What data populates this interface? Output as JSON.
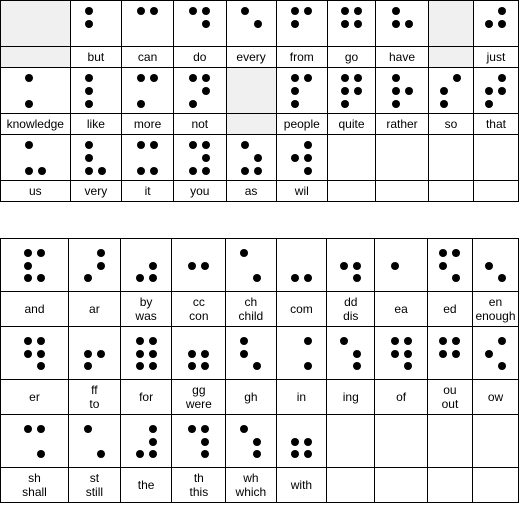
{
  "meta": {
    "title": "Braille contractions chart",
    "dot_color": "#000000",
    "grid_line_color": "#000000",
    "empty_cell_fill": "#f0f0f0",
    "background": "#ffffff"
  },
  "tables": [
    {
      "name": "alphabetic-wordsigns",
      "rows": [
        {
          "cells": [
            {
              "labels": [],
              "dots": [],
              "state": "empty"
            },
            {
              "labels": [
                "but"
              ],
              "dots": [
                1,
                2
              ],
              "state": "filled"
            },
            {
              "labels": [
                "can"
              ],
              "dots": [
                1,
                4
              ],
              "state": "filled"
            },
            {
              "labels": [
                "do"
              ],
              "dots": [
                1,
                4,
                5
              ],
              "state": "filled"
            },
            {
              "labels": [
                "every"
              ],
              "dots": [
                1,
                5
              ],
              "state": "filled"
            },
            {
              "labels": [
                "from"
              ],
              "dots": [
                1,
                2,
                4
              ],
              "state": "filled"
            },
            {
              "labels": [
                "go"
              ],
              "dots": [
                1,
                2,
                4,
                5
              ],
              "state": "filled"
            },
            {
              "labels": [
                "have"
              ],
              "dots": [
                1,
                2,
                5
              ],
              "state": "filled"
            },
            {
              "labels": [],
              "dots": [],
              "state": "empty"
            },
            {
              "labels": [
                "just"
              ],
              "dots": [
                2,
                4,
                5
              ],
              "state": "filled"
            }
          ]
        },
        {
          "cells": [
            {
              "labels": [
                "knowledge"
              ],
              "dots": [
                1,
                3
              ],
              "state": "filled"
            },
            {
              "labels": [
                "like"
              ],
              "dots": [
                1,
                2,
                3
              ],
              "state": "filled"
            },
            {
              "labels": [
                "more"
              ],
              "dots": [
                1,
                3,
                4
              ],
              "state": "filled"
            },
            {
              "labels": [
                "not"
              ],
              "dots": [
                1,
                3,
                4,
                5
              ],
              "state": "filled"
            },
            {
              "labels": [],
              "dots": [],
              "state": "empty"
            },
            {
              "labels": [
                "people"
              ],
              "dots": [
                1,
                2,
                3,
                4
              ],
              "state": "filled"
            },
            {
              "labels": [
                "quite"
              ],
              "dots": [
                1,
                2,
                3,
                4,
                5
              ],
              "state": "filled"
            },
            {
              "labels": [
                "rather"
              ],
              "dots": [
                1,
                2,
                3,
                5
              ],
              "state": "filled"
            },
            {
              "labels": [
                "so"
              ],
              "dots": [
                2,
                3,
                4
              ],
              "state": "filled"
            },
            {
              "labels": [
                "that"
              ],
              "dots": [
                2,
                3,
                4,
                5
              ],
              "state": "filled"
            }
          ]
        },
        {
          "cells": [
            {
              "labels": [
                "us"
              ],
              "dots": [
                1,
                3,
                6
              ],
              "state": "filled"
            },
            {
              "labels": [
                "very"
              ],
              "dots": [
                1,
                2,
                3,
                6
              ],
              "state": "filled"
            },
            {
              "labels": [
                "it"
              ],
              "dots": [
                1,
                3,
                4,
                6
              ],
              "state": "filled"
            },
            {
              "labels": [
                "you"
              ],
              "dots": [
                1,
                3,
                4,
                5,
                6
              ],
              "state": "filled"
            },
            {
              "labels": [
                "as"
              ],
              "dots": [
                1,
                3,
                5,
                6
              ],
              "state": "filled"
            },
            {
              "labels": [
                "wil"
              ],
              "dots": [
                2,
                4,
                5,
                6
              ],
              "state": "filled"
            },
            {
              "labels": [],
              "dots": [],
              "state": "blank"
            },
            {
              "labels": [],
              "dots": [],
              "state": "blank"
            },
            {
              "labels": [],
              "dots": [],
              "state": "blank"
            },
            {
              "labels": [],
              "dots": [],
              "state": "blank"
            }
          ]
        }
      ]
    },
    {
      "name": "contractions",
      "rows": [
        {
          "cells": [
            {
              "labels": [
                "and"
              ],
              "dots": [
                1,
                2,
                3,
                4,
                6
              ],
              "state": "filled"
            },
            {
              "labels": [
                "ar"
              ],
              "dots": [
                3,
                4,
                5
              ],
              "state": "filled"
            },
            {
              "labels": [
                "by",
                "was"
              ],
              "dots": [
                3,
                5,
                6
              ],
              "state": "filled"
            },
            {
              "labels": [
                "cc",
                "con"
              ],
              "dots": [
                2,
                5
              ],
              "state": "filled"
            },
            {
              "labels": [
                "ch",
                "child"
              ],
              "dots": [
                1,
                6
              ],
              "state": "filled"
            },
            {
              "labels": [
                "com"
              ],
              "dots": [
                3,
                6
              ],
              "state": "filled"
            },
            {
              "labels": [
                "dd",
                "dis"
              ],
              "dots": [
                2,
                5,
                6
              ],
              "state": "filled"
            },
            {
              "labels": [
                "ea"
              ],
              "dots": [
                2
              ],
              "state": "filled"
            },
            {
              "labels": [
                "ed"
              ],
              "dots": [
                1,
                2,
                4,
                6
              ],
              "state": "filled"
            },
            {
              "labels": [
                "en",
                "enough"
              ],
              "dots": [
                2,
                6
              ],
              "state": "filled"
            }
          ]
        },
        {
          "cells": [
            {
              "labels": [
                "er"
              ],
              "dots": [
                1,
                2,
                4,
                5,
                6
              ],
              "state": "filled"
            },
            {
              "labels": [
                "ff",
                "to"
              ],
              "dots": [
                2,
                3,
                5
              ],
              "state": "filled"
            },
            {
              "labels": [
                "for"
              ],
              "dots": [
                1,
                2,
                3,
                4,
                5,
                6
              ],
              "state": "filled"
            },
            {
              "labels": [
                "gg",
                "were"
              ],
              "dots": [
                2,
                3,
                5,
                6
              ],
              "state": "filled"
            },
            {
              "labels": [
                "gh"
              ],
              "dots": [
                1,
                2,
                6
              ],
              "state": "filled"
            },
            {
              "labels": [
                "in"
              ],
              "dots": [
                4,
                6
              ],
              "state": "filled"
            },
            {
              "labels": [
                "ing"
              ],
              "dots": [
                1,
                5,
                6
              ],
              "state": "filled"
            },
            {
              "labels": [
                "of"
              ],
              "dots": [
                1,
                2,
                4,
                5,
                6
              ],
              "state": "filled"
            },
            {
              "labels": [
                "ou",
                "out"
              ],
              "dots": [
                1,
                2,
                4,
                5
              ],
              "state": "filled"
            },
            {
              "labels": [
                "ow"
              ],
              "dots": [
                2,
                4,
                6
              ],
              "state": "filled"
            }
          ]
        },
        {
          "cells": [
            {
              "labels": [
                "sh",
                "shall"
              ],
              "dots": [
                1,
                4,
                6
              ],
              "state": "filled"
            },
            {
              "labels": [
                "st",
                "still"
              ],
              "dots": [
                1,
                6
              ],
              "state": "filled"
            },
            {
              "labels": [
                "the"
              ],
              "dots": [
                3,
                4,
                5,
                6
              ],
              "state": "filled"
            },
            {
              "labels": [
                "th",
                "this"
              ],
              "dots": [
                1,
                4,
                5,
                6
              ],
              "state": "filled"
            },
            {
              "labels": [
                "wh",
                "which"
              ],
              "dots": [
                1,
                5,
                6
              ],
              "state": "filled"
            },
            {
              "labels": [
                "with"
              ],
              "dots": [
                2,
                3,
                5,
                6
              ],
              "state": "filled"
            },
            {
              "labels": [],
              "dots": [],
              "state": "blank"
            },
            {
              "labels": [],
              "dots": [],
              "state": "blank"
            },
            {
              "labels": [],
              "dots": [],
              "state": "blank"
            },
            {
              "labels": [],
              "dots": [],
              "state": "blank"
            }
          ]
        }
      ]
    }
  ]
}
